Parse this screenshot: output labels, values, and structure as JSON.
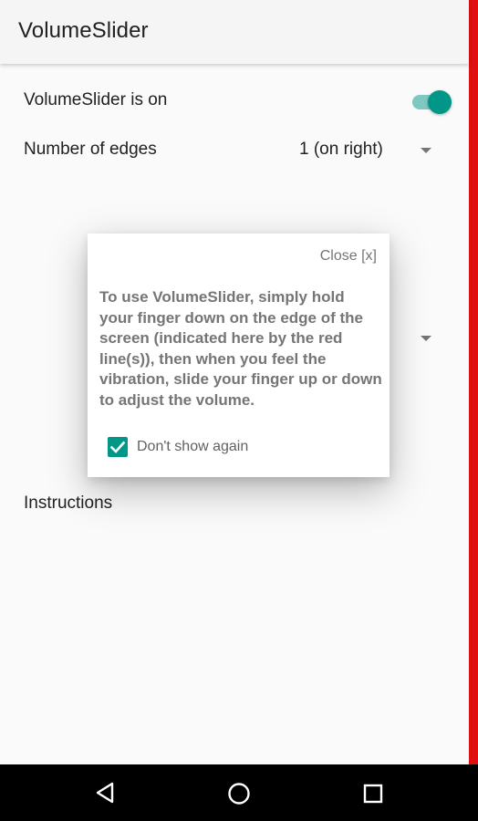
{
  "app_bar": {
    "title": "VolumeSlider"
  },
  "settings": {
    "toggle_label": "VolumeSlider is on",
    "toggle_state": "on",
    "edges_label": "Number of edges",
    "edges_value": "1 (on right)",
    "instructions_label": "Instructions"
  },
  "dialog": {
    "close_label": "Close [x]",
    "message": "To use VolumeSlider, simply hold your finger down on the edge of the screen (indicated here by the red line(s)), then when you feel the vibration, slide your finger up or down to adjust the volume.",
    "checkbox_label": "Don't show again",
    "checkbox_checked": true
  },
  "colors": {
    "accent": "#009688",
    "edge_line": "#e01010"
  },
  "icons": {
    "nav_back": "back-triangle-icon",
    "nav_home": "home-circle-icon",
    "nav_recents": "recents-square-icon"
  }
}
